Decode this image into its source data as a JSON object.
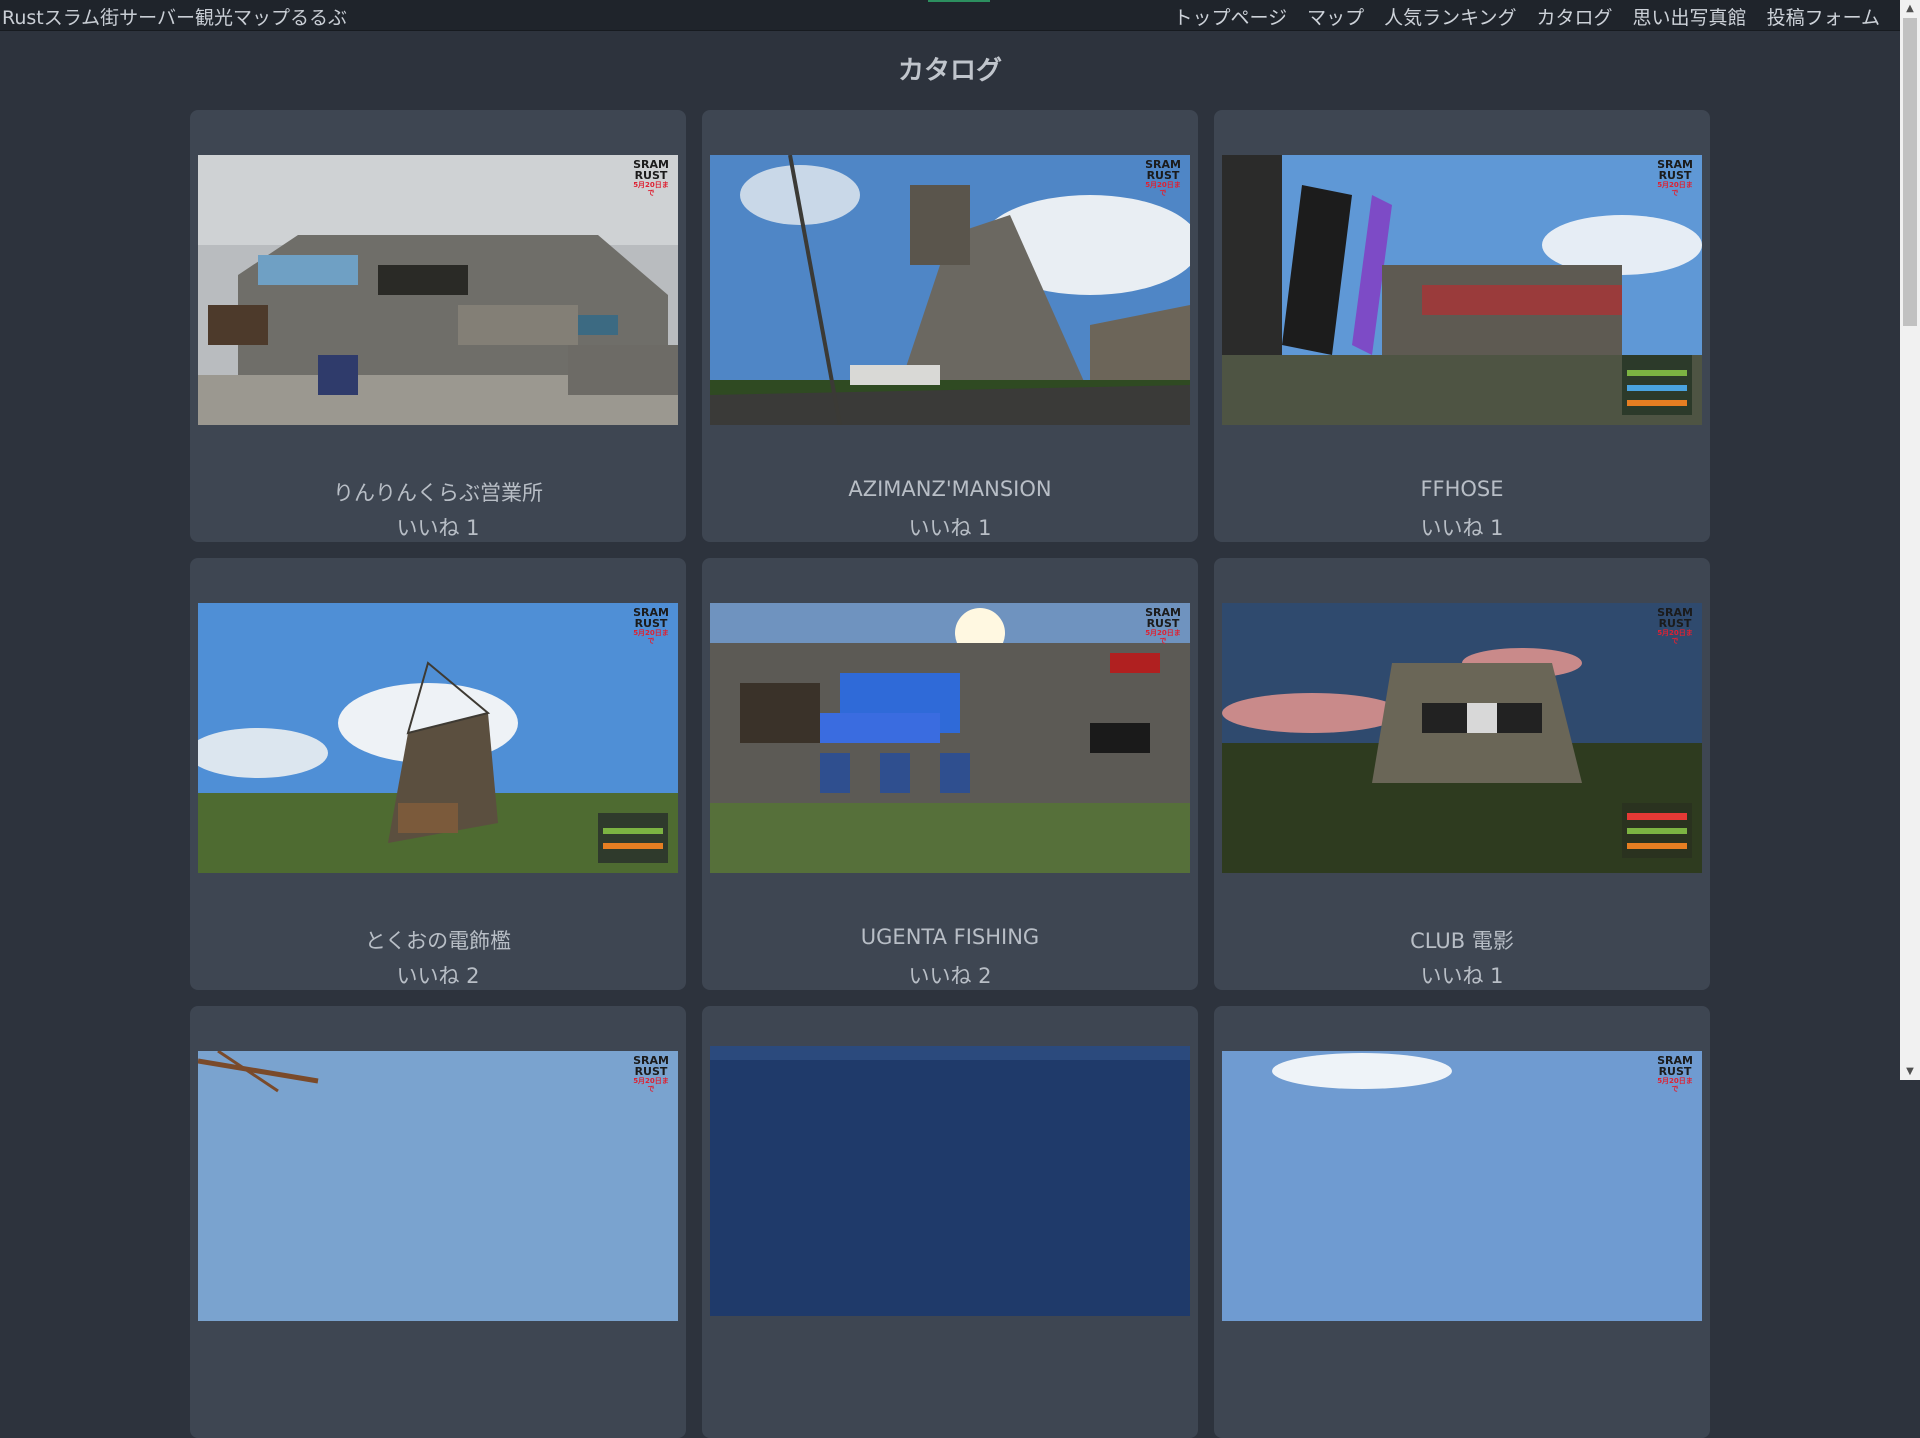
{
  "header": {
    "site_title": "Rustスラム街サーバー観光マップるるぶ",
    "nav": [
      "トップページ",
      "マップ",
      "人気ランキング",
      "カタログ",
      "思い出写真館",
      "投稿フォーム"
    ]
  },
  "page": {
    "title": "カタログ"
  },
  "cards": [
    {
      "name": "りんりんくらぶ営業所",
      "likes": "いいね 1"
    },
    {
      "name": "AZIMANZ'MANSION",
      "likes": "いいね 1"
    },
    {
      "name": "FFHOSE",
      "likes": "いいね 1"
    },
    {
      "name": "とくおの電飾檻",
      "likes": "いいね 2"
    },
    {
      "name": "UGENTA FISHING",
      "likes": "いいね 2"
    },
    {
      "name": "CLUB 電影",
      "likes": "いいね 1"
    }
  ],
  "logo": {
    "line1": "SRAM",
    "line2": "RUST",
    "line3": "5月20日まで"
  },
  "colors": {
    "background": "#2d333d",
    "card": "#3e4652",
    "topbar": "#1f242b",
    "accent": "#2c8f5f"
  }
}
